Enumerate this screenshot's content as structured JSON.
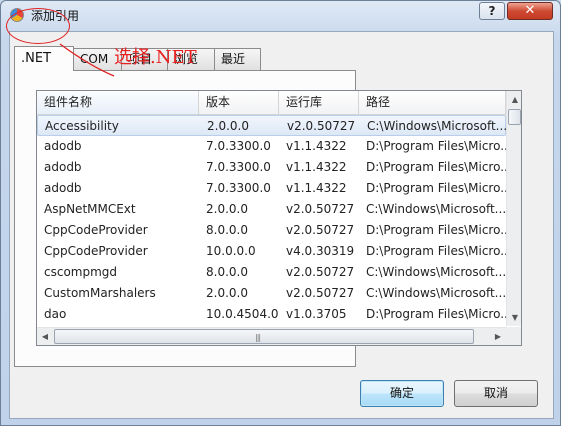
{
  "window": {
    "title": "添加引用",
    "help_label": "?",
    "close_label": "✕",
    "icon": "app-icon"
  },
  "tabs": [
    {
      "label": ".NET",
      "active": true
    },
    {
      "label": "COM",
      "active": false
    },
    {
      "label": "项目",
      "active": false
    },
    {
      "label": "浏览",
      "active": false
    },
    {
      "label": "最近",
      "active": false
    }
  ],
  "annotation": {
    "text": "选择.NET",
    "color": "#e82020"
  },
  "table": {
    "columns": [
      "组件名称",
      "版本",
      "运行库",
      "路径"
    ],
    "rows": [
      [
        "Accessibility",
        "2.0.0.0",
        "v2.0.50727",
        "C:\\Windows\\Microsoft..."
      ],
      [
        "adodb",
        "7.0.3300.0",
        "v1.1.4322",
        "D:\\Program Files\\Micro..."
      ],
      [
        "adodb",
        "7.0.3300.0",
        "v1.1.4322",
        "D:\\Program Files\\Micro..."
      ],
      [
        "adodb",
        "7.0.3300.0",
        "v1.1.4322",
        "D:\\Program Files\\Micro..."
      ],
      [
        "AspNetMMCExt",
        "2.0.0.0",
        "v2.0.50727",
        "C:\\Windows\\Microsoft..."
      ],
      [
        "CppCodeProvider",
        "8.0.0.0",
        "v2.0.50727",
        "D:\\Program Files\\Micro..."
      ],
      [
        "CppCodeProvider",
        "10.0.0.0",
        "v4.0.30319",
        "D:\\Program Files\\Micro..."
      ],
      [
        "cscompmgd",
        "8.0.0.0",
        "v2.0.50727",
        "C:\\Windows\\Microsoft..."
      ],
      [
        "CustomMarshalers",
        "2.0.0.0",
        "v2.0.50727",
        "C:\\Windows\\Microsoft..."
      ],
      [
        "dao",
        "10.0.4504.0",
        "v1.0.3705",
        "D:\\Program Files\\Micro..."
      ]
    ],
    "selected_row": 0
  },
  "buttons": {
    "ok_label": "确定",
    "cancel_label": "取消"
  },
  "scrollbar_icons": {
    "up": "▲",
    "down": "▼",
    "left": "◀",
    "right": "▶",
    "grip": "|||"
  }
}
